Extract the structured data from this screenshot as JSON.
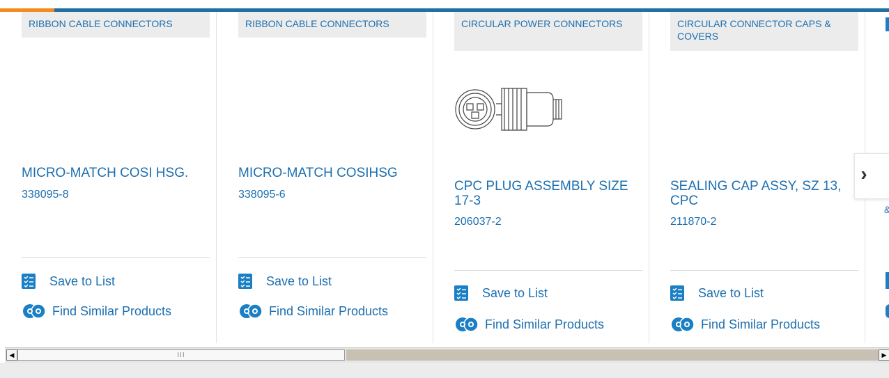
{
  "colors": {
    "accent_top": "#f28c1f",
    "brand_bar": "#1f6fa0",
    "link": "#1c6fb0",
    "icon_blue": "#1a7fc4"
  },
  "products": [
    {
      "category": "RIBBON CABLE CONNECTORS",
      "title": "MICRO-MATCH COSI HSG.",
      "part_number": "338095-8",
      "save_label": "Save to List",
      "similar_label": "Find Similar Products"
    },
    {
      "category": "RIBBON CABLE CONNECTORS",
      "title": "MICRO-MATCH COSIHSG",
      "part_number": "338095-6",
      "save_label": "Save to List",
      "similar_label": "Find Similar Products"
    },
    {
      "category": "CIRCULAR POWER CONNECTORS",
      "title": "CPC PLUG ASSEMBLY SIZE 17-3",
      "part_number": "206037-2",
      "save_label": "Save to List",
      "similar_label": "Find Similar Products"
    },
    {
      "category": "CIRCULAR CONNECTOR CAPS & COVERS",
      "title": "SEALING CAP ASSY, SZ 13, CPC",
      "part_number": "211870-2",
      "save_label": "Save to List",
      "similar_label": "Find Similar Products"
    }
  ],
  "next_button": {
    "icon": "chevron-right-icon",
    "glyph": "›"
  },
  "peek": {
    "char": "&"
  },
  "scrollbar": {
    "left_arrow": "◀",
    "right_arrow": "▶",
    "grip": "III"
  }
}
